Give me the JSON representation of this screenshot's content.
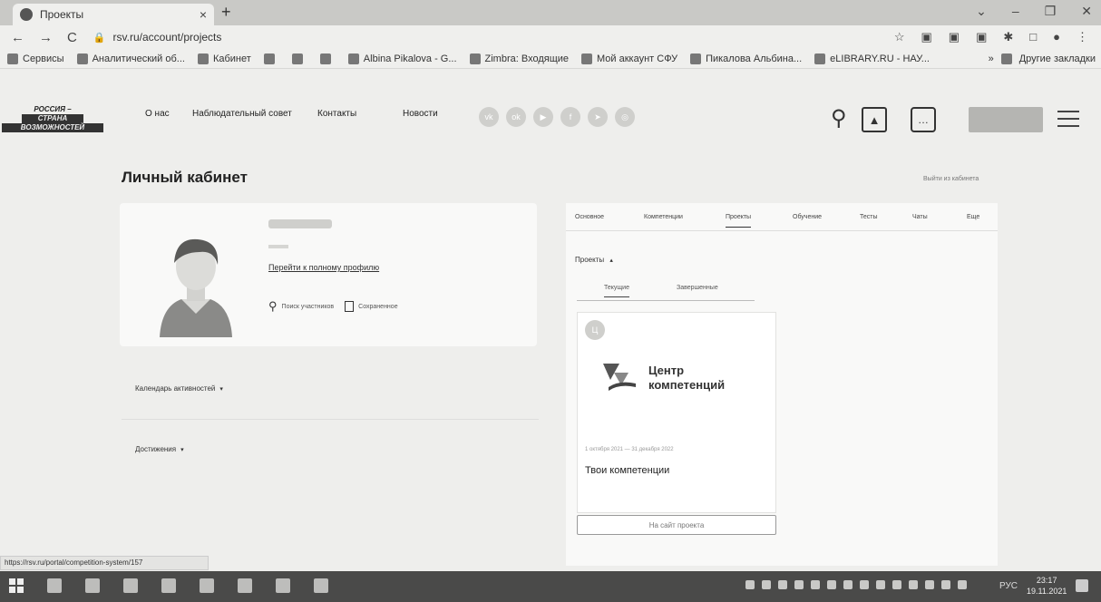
{
  "browser": {
    "tab_title": "Проекты",
    "tab_close": "×",
    "new_tab": "+",
    "url": "rsv.ru/account/projects",
    "nav_back": "←",
    "nav_forward": "→",
    "nav_reload": "C",
    "status_url": "https://rsv.ru/portal/competition-system/157"
  },
  "bookmarks": {
    "items": [
      "Сервисы",
      "Аналитический об...",
      "Кабинет",
      "Albina Pikalova - G...",
      "Zimbra: Входящие",
      "Мой аккаунт СФУ",
      "Пикалова Альбина...",
      "eLIBRARY.RU - НАУ..."
    ],
    "more": "»",
    "other": "Другие закладки"
  },
  "site": {
    "logo_line1": "РОССИЯ –",
    "logo_line2": "СТРАНА",
    "logo_line3": "ВОЗМОЖНОСТЕЙ",
    "nav": [
      "О нас",
      "Наблюдательный совет",
      "Контакты",
      "Новости"
    ],
    "socials": [
      "vk-icon",
      "ok-icon",
      "youtube-icon",
      "facebook-icon",
      "telegram-icon",
      "instagram-icon"
    ]
  },
  "page": {
    "title": "Личный кабинет",
    "exit": "Выйти из кабинета"
  },
  "profile": {
    "full_profile_link": "Перейти к полному профилю",
    "search_participants": "Поиск участников",
    "saved": "Сохраненное"
  },
  "sections": {
    "calendar": "Календарь активностей",
    "achievements": "Достижения",
    "caret": "▾"
  },
  "tabs": [
    "Основное",
    "Компетенции",
    "Проекты",
    "Обучение",
    "Тесты",
    "Чаты",
    "Еще"
  ],
  "projects": {
    "heading": "Проекты",
    "heading_caret": "▴",
    "subtabs": [
      "Текущие",
      "Завершенные"
    ],
    "card": {
      "badge": "Ц",
      "brand_line1": "Центр",
      "brand_line2": "компетенций",
      "dates": "1 октября 2021 — 31 декабря 2022",
      "title": "Твои компетенции"
    },
    "site_button": "На сайт проекта"
  },
  "taskbar": {
    "lang": "РУС",
    "time": "23:17",
    "date": "19.11.2021"
  },
  "colors": {
    "page_bg": "#eeeeec",
    "card_bg": "#f9f9f8",
    "taskbar_bg": "#4a4a49"
  }
}
